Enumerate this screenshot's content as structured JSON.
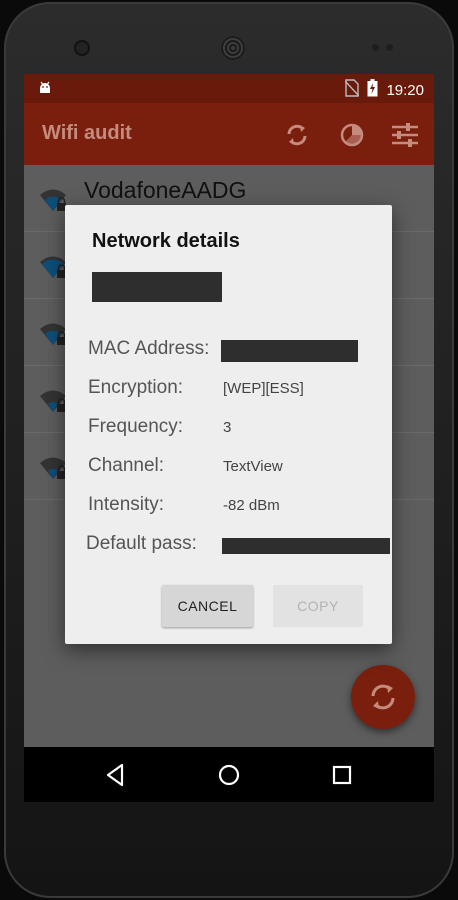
{
  "status_bar": {
    "time": "19:20",
    "icons": [
      "android-debug-icon",
      "no-sim-icon",
      "battery-charging-icon"
    ]
  },
  "app_bar": {
    "title": "Wifi audit",
    "actions": [
      "refresh-icon",
      "pie-chart-icon",
      "settings-sliders-icon"
    ]
  },
  "network_list": {
    "items": [
      {
        "ssid": "VodafoneAADG",
        "icon": "wifi-locked-icon"
      },
      {
        "ssid": "",
        "icon": "wifi-locked-icon"
      },
      {
        "ssid": "",
        "icon": "wifi-locked-icon"
      },
      {
        "ssid": "",
        "icon": "wifi-locked-icon"
      },
      {
        "ssid": "",
        "icon": "wifi-locked-icon"
      }
    ]
  },
  "dialog": {
    "title": "Network details",
    "rows": [
      {
        "label": "MAC Address:",
        "value": ""
      },
      {
        "label": "Encryption:",
        "value": "[WEP][ESS]"
      },
      {
        "label": "Frequency:",
        "value": "3"
      },
      {
        "label": "Channel:",
        "value": "TextView"
      },
      {
        "label": "Intensity:",
        "value": "-82 dBm"
      },
      {
        "label": "Default pass:",
        "value": ""
      }
    ],
    "cancel_label": "CANCEL",
    "copy_label": "COPY"
  },
  "colors": {
    "accent": "#7a1f0d",
    "status_bar": "#6a1a0b",
    "dialog_bg": "#eeeeee"
  }
}
